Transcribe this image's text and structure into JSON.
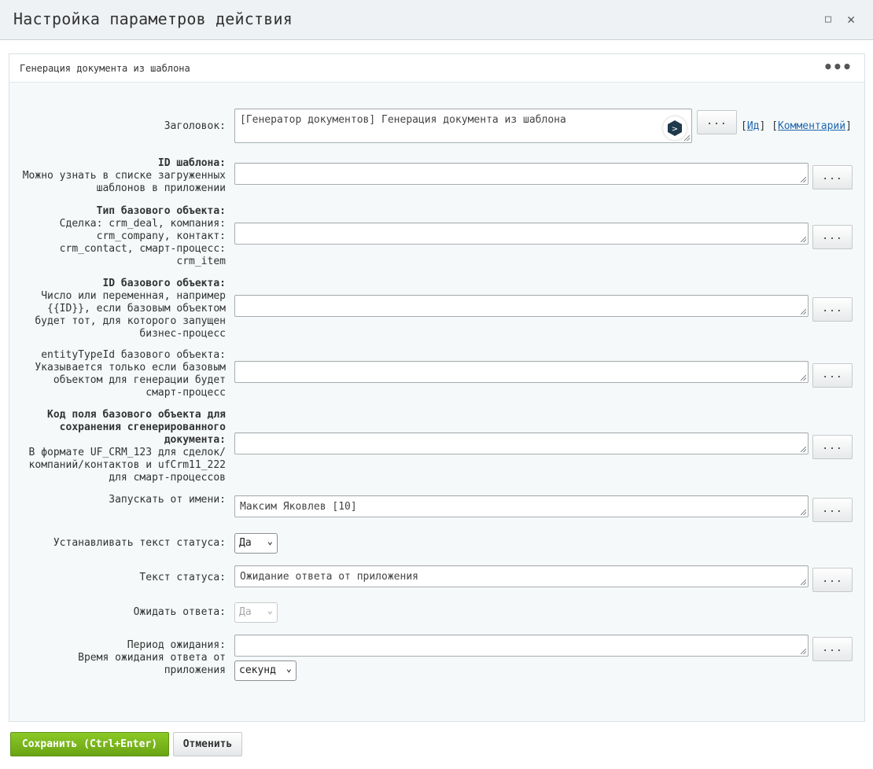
{
  "window": {
    "title": "Настройка параметров действия",
    "maximize_icon": "□",
    "close_icon": "✕"
  },
  "panel": {
    "title": "Генерация документа из шаблона",
    "menu_icon": "•••"
  },
  "fields": {
    "heading": {
      "label": "Заголовок:",
      "value": "[Генератор документов] Генерация документа из шаблона",
      "button": "...",
      "link_id_open": "[",
      "link_id": "Ид",
      "link_id_close": "]",
      "link_comment_open": "[",
      "link_comment": "Комментарий",
      "link_comment_close": "]"
    },
    "template_id": {
      "label_bold": "ID шаблона:",
      "hint": [
        "Можно узнать в списке загруженных",
        "шаблонов в приложении"
      ],
      "value": "",
      "button": "..."
    },
    "base_type": {
      "label_bold": "Тип базового объекта:",
      "hint": [
        "Сделка: crm_deal, компания:",
        "crm_company, контакт:",
        "crm_contact, смарт-процесс:",
        "crm_item"
      ],
      "value": "",
      "button": "..."
    },
    "base_id": {
      "label_bold": "ID базового объекта:",
      "hint": [
        "Число или переменная, например",
        "{{ID}}, если базовым объектом",
        "будет тот, для которого запущен",
        "бизнес-процесс"
      ],
      "value": "",
      "button": "..."
    },
    "entity_type": {
      "label": [
        "entityTypeId базового объекта:",
        "Указывается только если базовым",
        "объектом для генерации будет",
        "смарт-процесс"
      ],
      "value": "",
      "button": "..."
    },
    "field_code": {
      "label_bold": [
        "Код поля базового объекта для",
        "сохранения сгенерированного",
        "документа:"
      ],
      "hint": [
        "В формате UF_CRM_123 для сделок/",
        "компаний/контактов и ufCrm11_222",
        "для смарт-процессов"
      ],
      "value": "",
      "button": "..."
    },
    "run_as": {
      "label": "Запускать от имени:",
      "value": "Максим Яковлев [10]",
      "button": "..."
    },
    "set_status": {
      "label": "Устанавливать текст статуса:",
      "selected": "Да"
    },
    "status_text": {
      "label": "Текст статуса:",
      "value": "Ожидание ответа от приложения",
      "button": "..."
    },
    "wait_answer": {
      "label": "Ожидать ответа:",
      "selected": "Да"
    },
    "wait_period": {
      "label": [
        "Период ожидания:",
        "Время ожидания ответа от",
        "приложения"
      ],
      "value": "",
      "button": "...",
      "unit_selected": "секунд"
    }
  },
  "footer": {
    "save_label": "Сохранить (Ctrl+Enter)",
    "cancel_label": "Отменить"
  }
}
